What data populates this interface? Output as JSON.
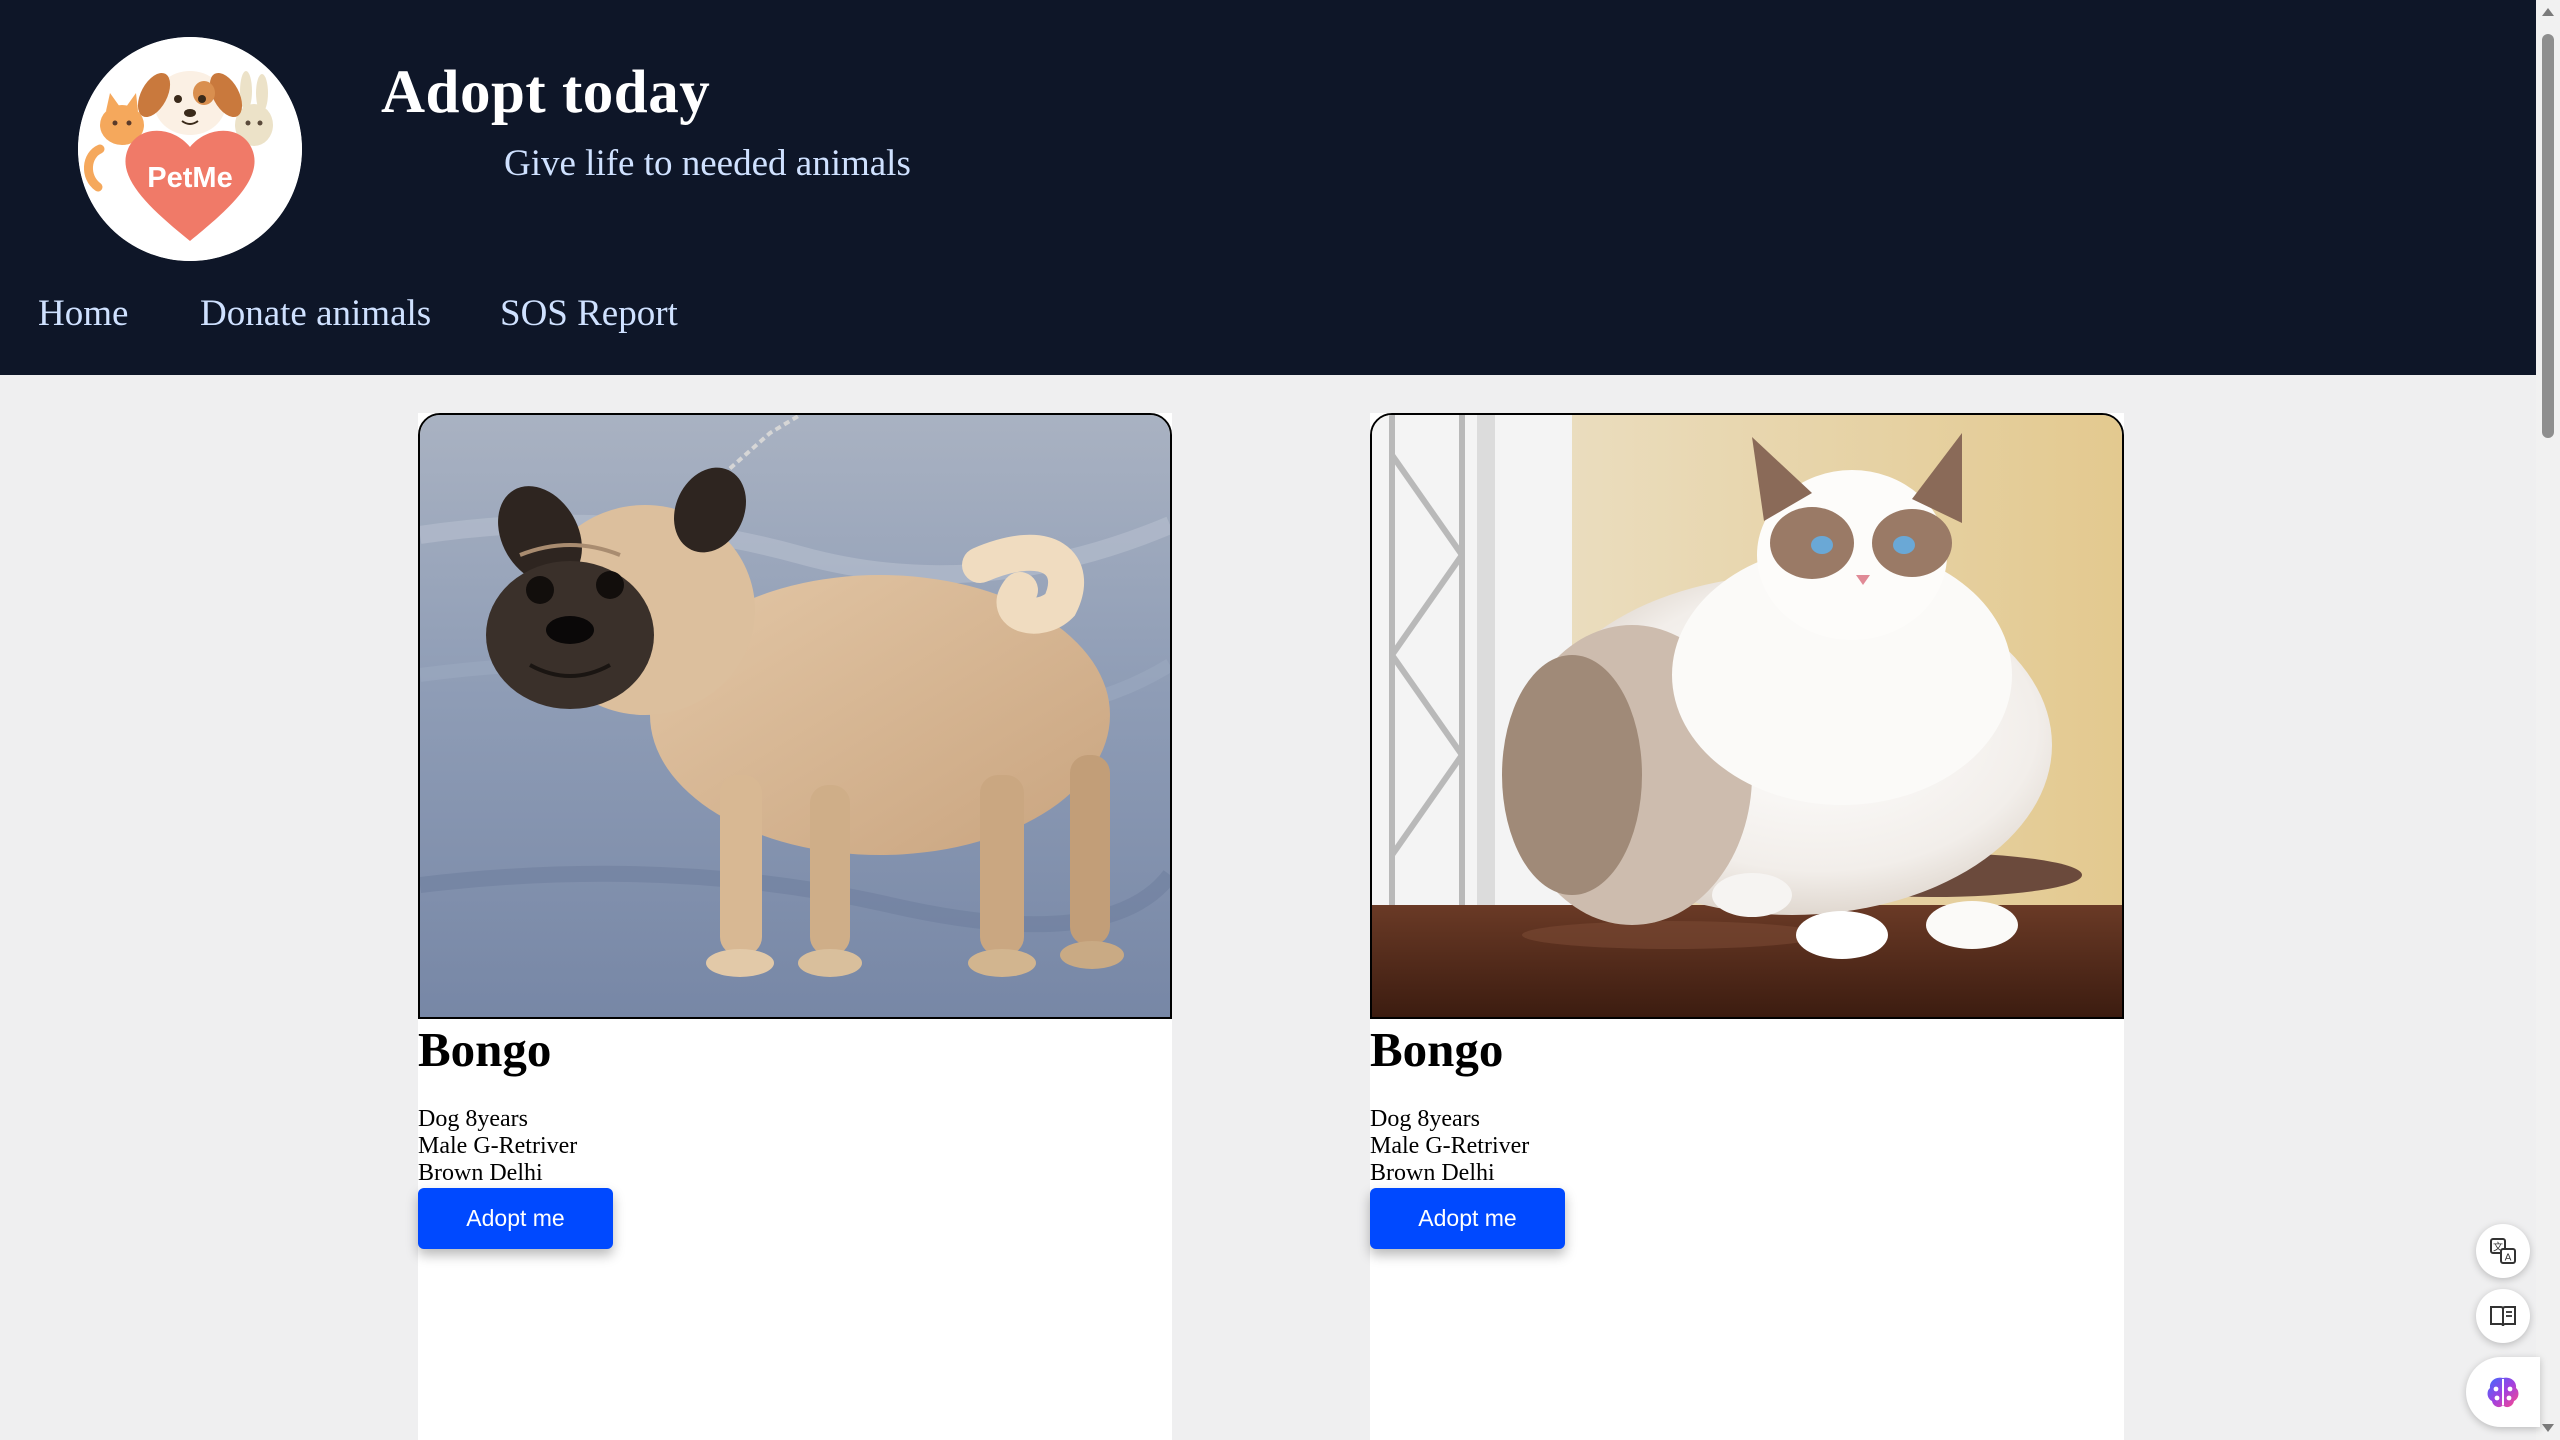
{
  "header": {
    "logo_text": "PetMe",
    "title": "Adopt today",
    "subtitle": "Give life to needed animals"
  },
  "nav": {
    "items": [
      {
        "label": "Home"
      },
      {
        "label": "Donate animals"
      },
      {
        "label": "SOS Report"
      }
    ]
  },
  "cards": [
    {
      "image": "pug-dog-photo",
      "name": "Bongo",
      "details": [
        "Dog 8years",
        "Male G-Retriver",
        "Brown Delhi"
      ],
      "button_label": "Adopt me"
    },
    {
      "image": "ragdoll-cat-photo",
      "name": "Bongo",
      "details": [
        "Dog 8years",
        "Male G-Retriver",
        "Brown Delhi"
      ],
      "button_label": "Adopt me"
    }
  ],
  "side_tools": [
    "translate-icon",
    "reader-mode-icon",
    "ai-assistant-icon"
  ],
  "colors": {
    "header_bg": "#0e1628",
    "nav_text": "#cfe1ff",
    "button_bg": "#0049ff",
    "page_bg": "#efeff0",
    "logo_heart": "#f07a68"
  }
}
